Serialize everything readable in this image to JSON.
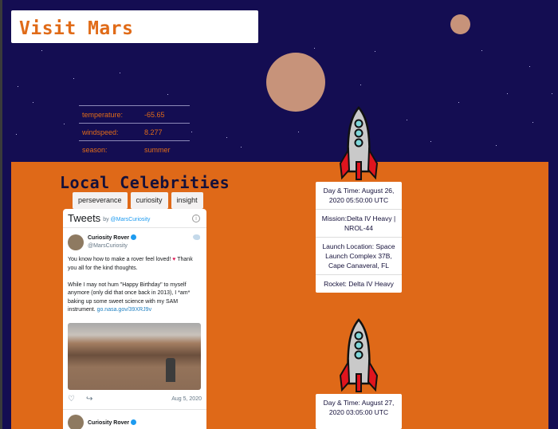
{
  "header": {
    "title": "Visit Mars"
  },
  "weather": {
    "rows": [
      {
        "label": "temperature:",
        "value": "-65.65"
      },
      {
        "label": "windspeed:",
        "value": "8.277"
      },
      {
        "label": "season:",
        "value": "summer"
      }
    ]
  },
  "celebrities": {
    "title": "Local Celebrities",
    "tabs": [
      "perseverance",
      "curiosity",
      "insight"
    ]
  },
  "tweets": {
    "heading": "Tweets",
    "by_label": "by",
    "account": "@MarsCuriosity",
    "items": [
      {
        "user": "Curiosity Rover",
        "handle": "@MarsCuriosity",
        "text_a": "You know how to make a rover feel loved! ",
        "heart": "♥",
        "text_b": " Thank you all for the kind thoughts.\n\nWhile I may not hum \"Happy Birthday\" to myself anymore (only did that once back in 2013), I *am* baking up some sweet science with my SAM instrument. ",
        "link": "go.nasa.gov/39XRJ9v",
        "date": "Aug 5, 2020"
      },
      {
        "user": "Curiosity Rover"
      }
    ]
  },
  "launches": [
    {
      "datetime": "Day & Time: August 26, 2020 05:50:00 UTC",
      "mission": "Mission:Delta IV Heavy | NROL-44",
      "location": "Launch Location: Space Launch Complex 37B, Cape Canaveral, FL",
      "rocket": "Rocket: Delta IV Heavy"
    },
    {
      "datetime": "Day & Time: August 27, 2020 03:05:00 UTC"
    }
  ],
  "colors": {
    "space": "#140d52",
    "mars_orange": "#df6918",
    "planet": "#c7937a",
    "rocket_red": "#e0141e"
  },
  "icons": [
    "rocket-icon",
    "info-icon",
    "verified-icon",
    "twitter-bird-icon",
    "heart-icon",
    "share-icon"
  ]
}
